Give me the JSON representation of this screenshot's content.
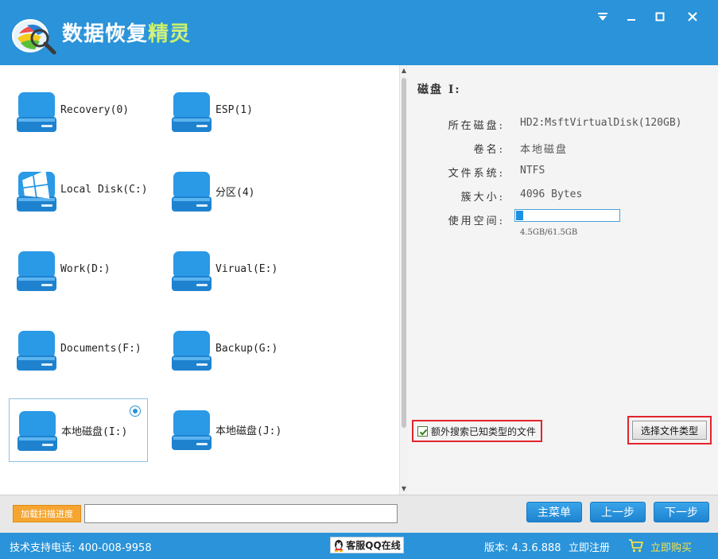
{
  "app": {
    "title_part1": "数据恢复",
    "title_part2": "精灵"
  },
  "window_controls": [
    "menu-icon",
    "minimize-icon",
    "maximize-icon",
    "close-icon"
  ],
  "drives": [
    {
      "label": "Recovery(0)",
      "icon": "disk-icon"
    },
    {
      "label": "ESP(1)",
      "icon": "disk-icon"
    },
    {
      "label": "Local Disk(C:)",
      "icon": "windows-disk-icon"
    },
    {
      "label": "分区(4)",
      "icon": "disk-icon"
    },
    {
      "label": "Work(D:)",
      "icon": "disk-icon"
    },
    {
      "label": "Virual(E:)",
      "icon": "disk-icon"
    },
    {
      "label": "Documents(F:)",
      "icon": "disk-icon"
    },
    {
      "label": "Backup(G:)",
      "icon": "disk-icon"
    },
    {
      "label": "本地磁盘(I:)",
      "icon": "disk-icon",
      "selected": true
    },
    {
      "label": "本地磁盘(J:)",
      "icon": "disk-icon"
    }
  ],
  "details": {
    "title": "磁盘 I:",
    "rows": [
      {
        "key": "所在磁盘:",
        "value": "HD2:MsftVirtualDisk(120GB)"
      },
      {
        "key": "卷名:",
        "value": "本地磁盘"
      },
      {
        "key": "文件系统:",
        "value": "NTFS"
      },
      {
        "key": "簇大小:",
        "value": "4096 Bytes"
      },
      {
        "key": "使用空间:",
        "value": ""
      }
    ],
    "usage_text": "4.5GB/61.5GB",
    "usage_fraction": 0.073
  },
  "options": {
    "extra_search_label": "额外搜索已知类型的文件",
    "extra_search_checked": true,
    "select_types_label": "选择文件类型"
  },
  "bottom": {
    "load_progress_label": "加载扫描进度",
    "progress_value": "",
    "main_menu": "主菜单",
    "prev": "上一步",
    "next": "下一步"
  },
  "status": {
    "support": "技术支持电话: 400-008-9958",
    "qq": "客服QQ在线",
    "version": "版本: 4.3.6.888",
    "register": "立即注册",
    "buy": "立即购买"
  },
  "colors": {
    "brand": "#2a93d9",
    "highlight": "#e3232c",
    "buy": "#f5e04a",
    "load": "#f5a530"
  }
}
